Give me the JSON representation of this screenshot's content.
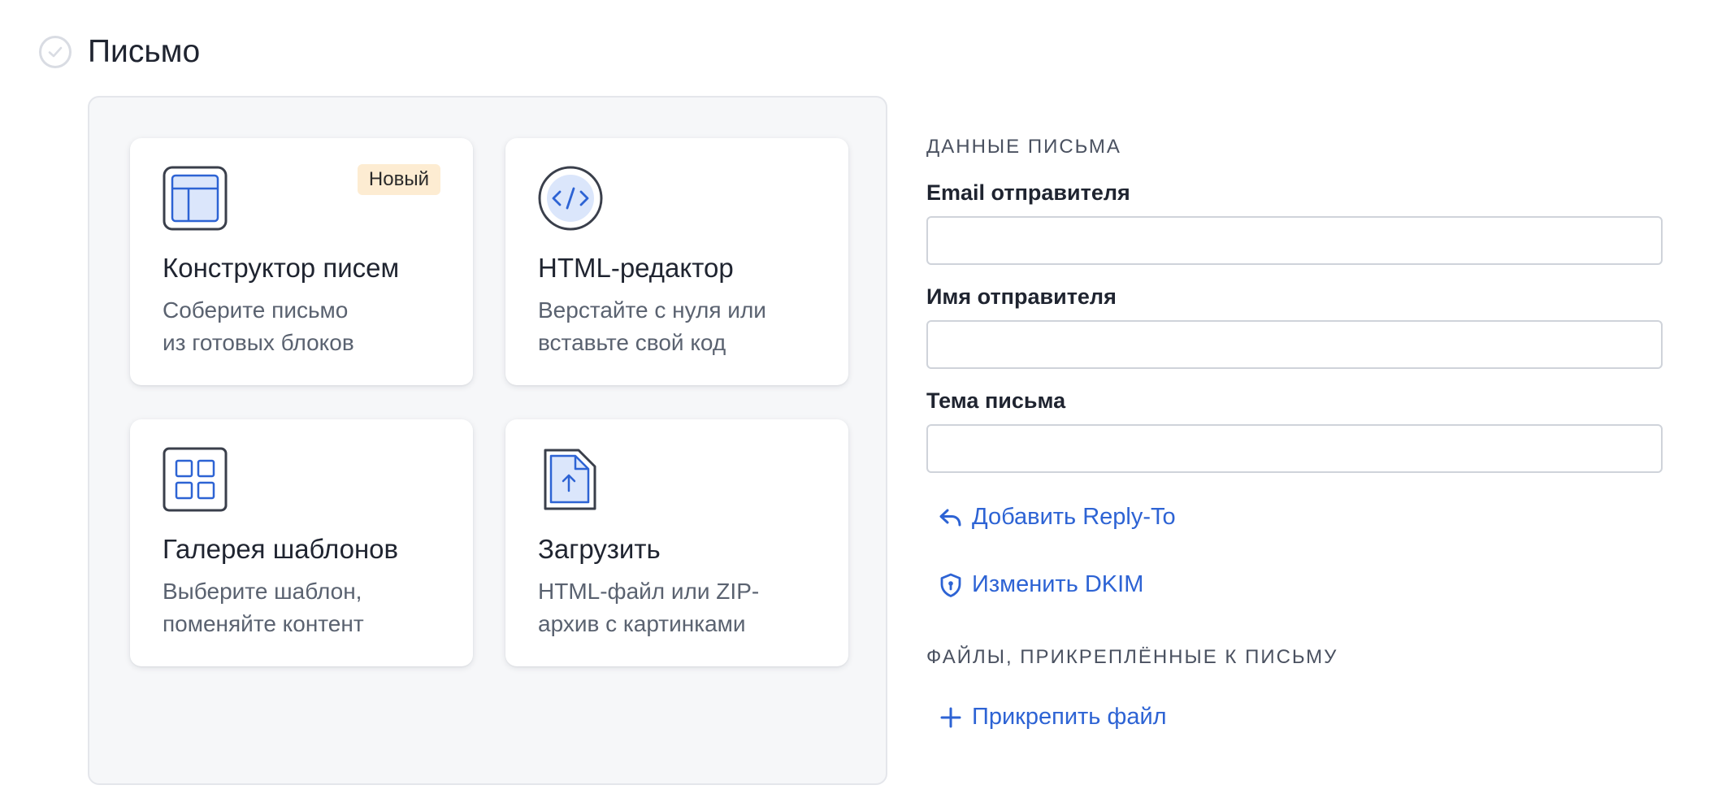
{
  "section": {
    "title": "Письмо",
    "check_icon": "check-circle-icon"
  },
  "cards": [
    {
      "icon": "layout-builder-icon",
      "title": "Конструктор писем",
      "desc": "Соберите письмо\nиз готовых блоков",
      "badge": "Новый"
    },
    {
      "icon": "code-icon",
      "title": "HTML-редактор",
      "desc": "Верстайте с нуля или\nвставьте свой код"
    },
    {
      "icon": "grid-gallery-icon",
      "title": "Галерея шаблонов",
      "desc": "Выберите шаблон,\nпоменяйте контент"
    },
    {
      "icon": "file-upload-icon",
      "title": "Загрузить",
      "desc": "HTML-файл или ZIP-\nархив с картинками"
    }
  ],
  "form": {
    "group_label": "Данные письма",
    "fields": [
      {
        "label": "Email отправителя",
        "value": "",
        "placeholder": ""
      },
      {
        "label": "Имя отправителя",
        "value": "",
        "placeholder": ""
      },
      {
        "label": "Тема письма",
        "value": "",
        "placeholder": ""
      }
    ],
    "reply_to_link": "Добавить Reply-To",
    "dkim_link": "Изменить DKIM",
    "attachments_label": "Файлы, прикреплённые к письму",
    "attach_link": "Прикрепить файл"
  },
  "colors": {
    "accent": "#2d63d4",
    "icon_stroke": "#3a3f4b",
    "icon_fill": "#dbe6fb",
    "badge_bg": "#fdecd2"
  }
}
